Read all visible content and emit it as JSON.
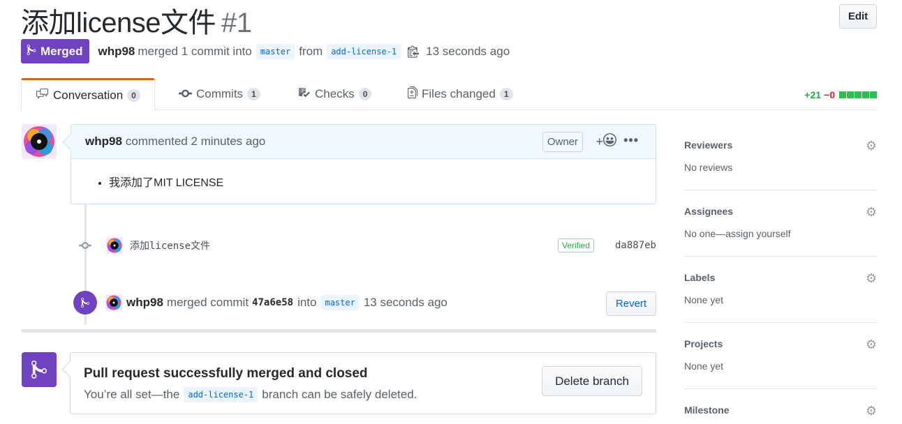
{
  "header": {
    "title": "添加license文件",
    "number": "#1",
    "edit_label": "Edit",
    "status_label": "Merged",
    "author": "whp98",
    "merged_text": "merged 1 commit into",
    "base_branch": "master",
    "from_text": "from",
    "head_branch": "add-license-1",
    "time": "13 seconds ago"
  },
  "tabs": [
    {
      "label": "Conversation",
      "count": "0",
      "icon": "comment-discussion-icon"
    },
    {
      "label": "Commits",
      "count": "1",
      "icon": "git-commit-icon"
    },
    {
      "label": "Checks",
      "count": "0",
      "icon": "checklist-icon"
    },
    {
      "label": "Files changed",
      "count": "1",
      "icon": "file-diff-icon"
    }
  ],
  "diffstat": {
    "additions": "+21",
    "deletions": "−0"
  },
  "comment": {
    "author": "whp98",
    "action": "commented 2 minutes ago",
    "role": "Owner",
    "reaction_label": "+",
    "body_item": "我添加了MIT LICENSE"
  },
  "commit": {
    "message": "添加license文件",
    "verified": "Verified",
    "sha": "da887eb"
  },
  "merge_event": {
    "author": "whp98",
    "text1": "merged commit",
    "sha": "47a6e58",
    "text2": "into",
    "branch": "master",
    "time": "13 seconds ago",
    "revert_label": "Revert"
  },
  "merge_box": {
    "title": "Pull request successfully merged and closed",
    "sub1": "You’re all set—the",
    "branch": "add-license-1",
    "sub2": "branch can be safely deleted.",
    "delete_label": "Delete branch"
  },
  "sidebar": [
    {
      "heading": "Reviewers",
      "value": "No reviews"
    },
    {
      "heading": "Assignees",
      "value": "No one—assign yourself"
    },
    {
      "heading": "Labels",
      "value": "None yet"
    },
    {
      "heading": "Projects",
      "value": "None yet"
    },
    {
      "heading": "Milestone",
      "value": ""
    }
  ],
  "colors": {
    "merged_purple": "#6f42c1",
    "link_blue": "#0366d6",
    "add_green": "#28a745",
    "del_red": "#cb2431",
    "tab_accent": "#e36209"
  }
}
